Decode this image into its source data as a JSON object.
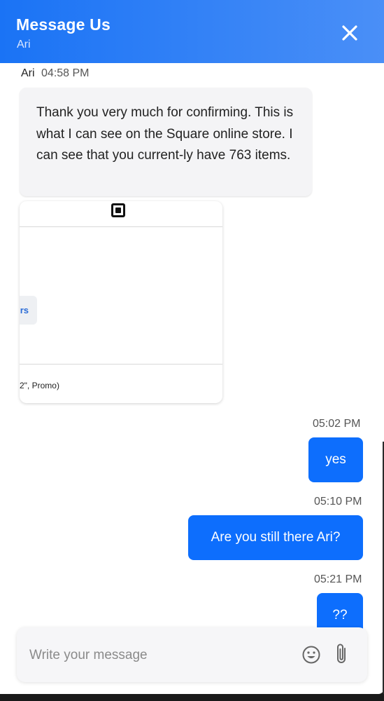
{
  "header": {
    "title": "Message Us",
    "subtitle": "Ari",
    "close_icon": "close-icon"
  },
  "messages": {
    "agent": {
      "sender": "Ari",
      "time": "04:58 PM",
      "text": "Thank you very much for confirming. This is what I can see on the Square online store. I can see that you current-ly have 763 items."
    },
    "attachment": {
      "logo_icon": "square-logo-icon",
      "chip_text": "rs",
      "caption": "2\", Promo)"
    },
    "user": [
      {
        "time": "05:02 PM",
        "text": "yes"
      },
      {
        "time": "05:10 PM",
        "text": "Are you still there Ari?"
      },
      {
        "time": "05:21 PM",
        "text": "??"
      }
    ]
  },
  "composer": {
    "placeholder": "Write your message",
    "value": "",
    "emoji_icon": "emoji-icon",
    "attach_icon": "paperclip-icon"
  },
  "colors": {
    "header_start": "#1a73f5",
    "header_end": "#4a8ff7",
    "user_bubble": "#0d6efd",
    "agent_bubble": "#f4f4f6"
  }
}
